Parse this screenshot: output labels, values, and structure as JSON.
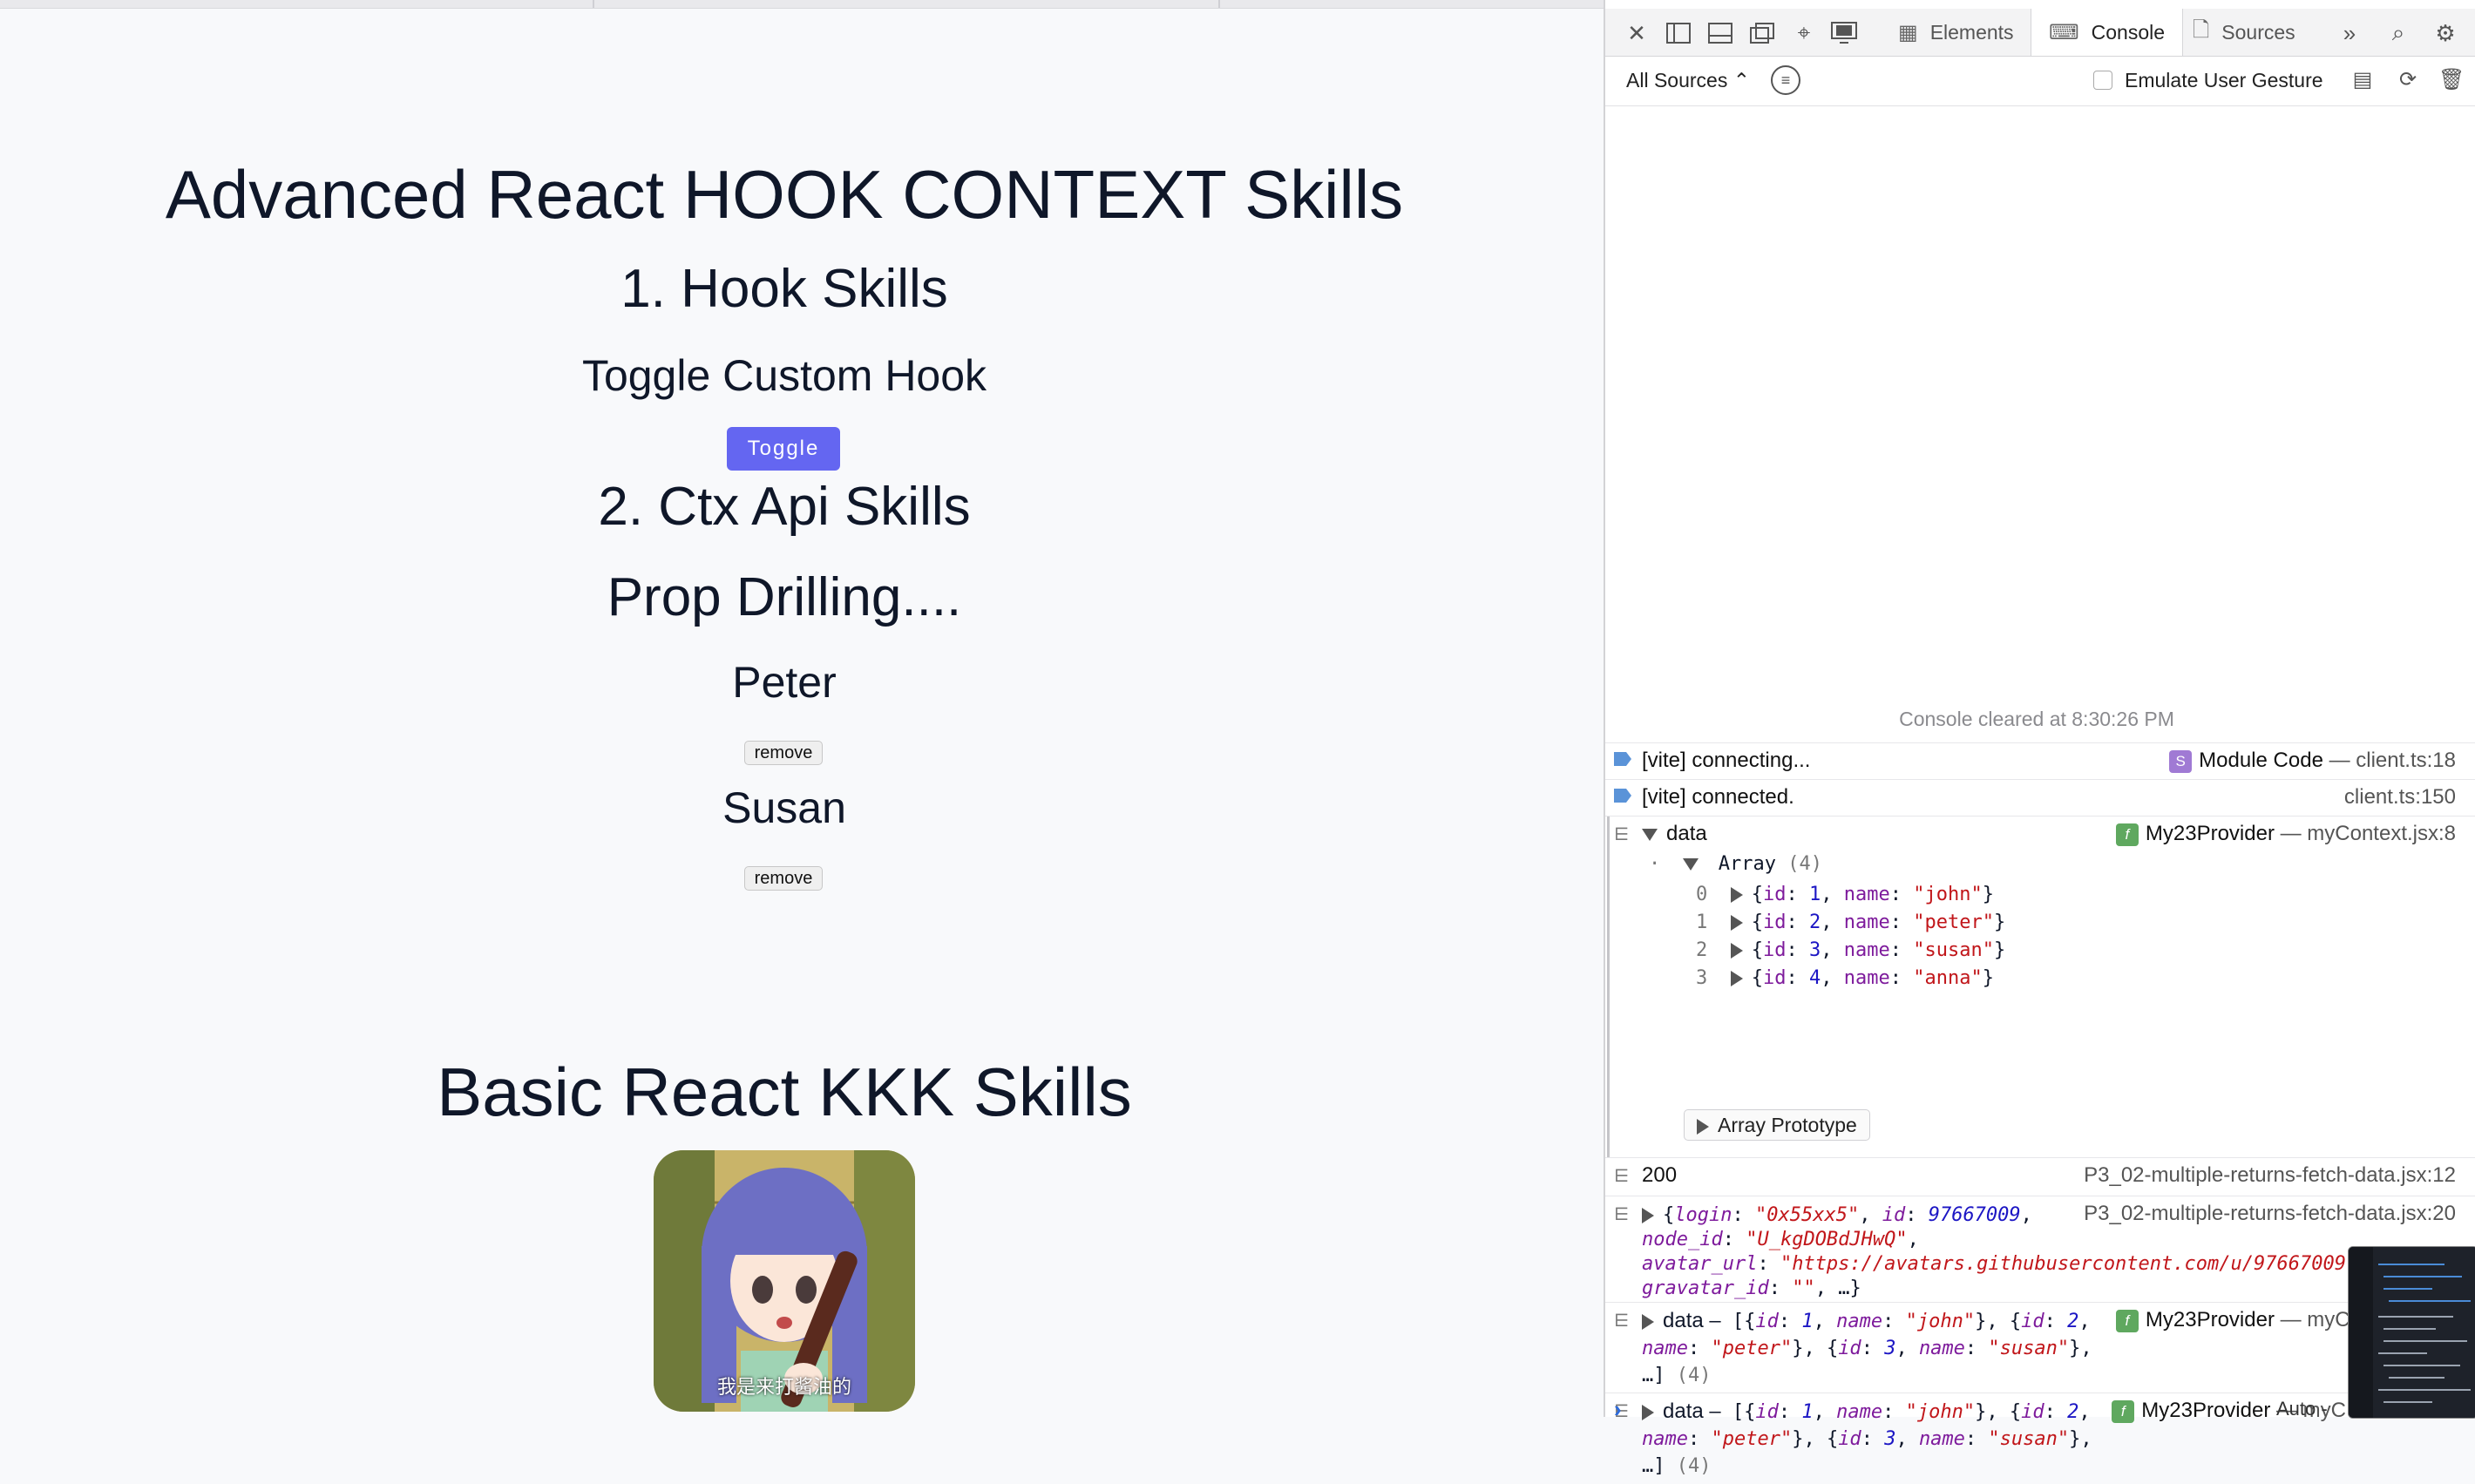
{
  "page": {
    "title": "Advanced React HOOK CONTEXT Skills",
    "hook_heading": "1. Hook Skills",
    "toggle_heading": "Toggle Custom Hook",
    "toggle_button": "Toggle",
    "ctx_heading": "2. Ctx Api Skills",
    "prop_heading": "Prop Drilling....",
    "people": [
      {
        "name": "Peter",
        "remove_label": "remove"
      },
      {
        "name": "Susan",
        "remove_label": "remove"
      }
    ],
    "basic_heading": "Basic React KKK Skills",
    "avatar_caption": "我是来打酱油的"
  },
  "devtools": {
    "tabs": [
      {
        "label": "Elements",
        "icon": "elements-icon"
      },
      {
        "label": "Console",
        "icon": "console-icon",
        "active": true
      },
      {
        "label": "Sources",
        "icon": "sources-icon"
      }
    ],
    "filter": {
      "sources_label": "All Sources",
      "emulate_label": "Emulate User Gesture"
    },
    "console": {
      "cleared": "Console cleared at 8:30:26 PM",
      "rows": [
        {
          "msg": "[vite] connecting...",
          "badge": "S",
          "fn": "Module Code",
          "src": "client.ts:18"
        },
        {
          "msg": "[vite] connected.",
          "src": "client.ts:150"
        },
        {
          "msg": "data",
          "badge": "f",
          "fn": "My23Provider",
          "src": "myContext.jsx:8"
        },
        {
          "msg": "200",
          "src": "P3_02-multiple-returns-fetch-data.jsx:12"
        },
        {
          "src": "P3_02-multiple-returns-fetch-data.jsx:20"
        },
        {
          "msg": "data",
          "badge": "f",
          "fn": "My23Provider",
          "src": "myContext.jsx:8"
        },
        {
          "msg": "data",
          "badge": "f",
          "fn": "My23Provider",
          "src": "myC"
        }
      ],
      "array_label": "Array",
      "array_count": "(4)",
      "array_items": [
        {
          "index": "0",
          "id": "1",
          "name": "\"john\""
        },
        {
          "index": "1",
          "id": "2",
          "name": "\"peter\""
        },
        {
          "index": "2",
          "id": "3",
          "name": "\"susan\""
        },
        {
          "index": "3",
          "id": "4",
          "name": "\"anna\""
        }
      ],
      "array_prototype": "Array Prototype",
      "fetch_obj": {
        "login": "\"0x55xx5\"",
        "id": "97667009",
        "node_id": "\"U_kgDOBdJHwQ\"",
        "avatar_url": "\"https://avatars.githubusercontent.com/u/97667009?v=4\"",
        "gravatar_id": "\"\""
      },
      "count": "(4)",
      "auto_label": "Auto -"
    }
  }
}
